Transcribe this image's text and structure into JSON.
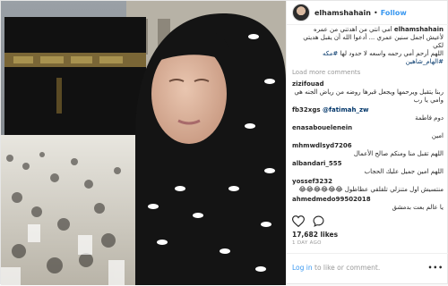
{
  "profile": {
    "username": "elhamshahain",
    "separator": "•",
    "follow_label": "Follow"
  },
  "caption": {
    "username": "elhamshahain",
    "line1": "أمي انتي من أهدتني من عمره",
    "line2": "لأعيش اجمل سنين عمري ... أدعوا الله أن يقبل هديتي لكي",
    "line3": "اللهم أرحم أمي رحمه واسعه لا حدود لها",
    "hashtag1": "#مكه",
    "hashtag2": "#الهام_شاهين"
  },
  "load_more": "Load more comments",
  "comments": [
    {
      "user": "zizifouad",
      "text": "ربنا يتقبل ويرحمها ويجعل قبرها روضه من رياض الجنه هي وامي يا رب"
    },
    {
      "user": "fb32xgs",
      "mention": "@fatimah_zw",
      "text": "دوم فاطمة"
    },
    {
      "user": "enasabouelenein",
      "text": "امين"
    },
    {
      "user": "mhmwdlsyd7206",
      "text": "اللهم تقبل منا ومنكم صالح الأعمال"
    },
    {
      "user": "albandari_555",
      "text": "اللهم امين جميل عليك الحجاب"
    },
    {
      "user": "yossef3232",
      "text": "منتسيش اول متنزلي تلقلقي عظاظول 😂😂😂😂😂😂"
    },
    {
      "user": "ahmedmedo99502018",
      "text": "يا عالم بعت بدمشق"
    }
  ],
  "likes": "17,682 likes",
  "time": "1 DAY AGO",
  "footer": {
    "login_label": "Log in",
    "rest": " to like or comment.",
    "menu": "•••"
  },
  "colors": {
    "link_blue": "#3897f0",
    "text": "#262626",
    "muted": "#999999"
  },
  "icons": [
    "heart-icon",
    "comment-icon"
  ]
}
